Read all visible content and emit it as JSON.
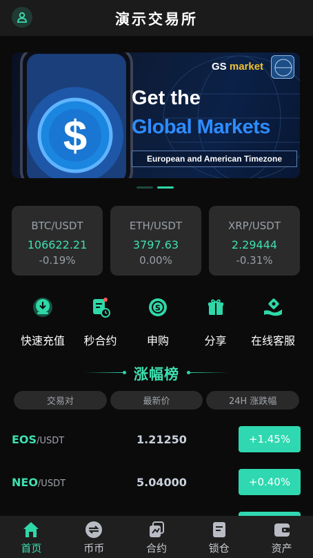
{
  "header": {
    "title": "演示交易所",
    "avatar_icon": "user-icon"
  },
  "banner": {
    "brand_gs": "GS",
    "brand_market": "market",
    "seal_text": "Goldman Sachs",
    "line1": "Get the",
    "line2": "Global Markets",
    "subtitle": "European and American Timezone",
    "active_slide": 1,
    "slide_count": 2
  },
  "tickers": [
    {
      "pair": "BTC/USDT",
      "price": "106622.21",
      "change": "-0.19%"
    },
    {
      "pair": "ETH/USDT",
      "price": "3797.63",
      "change": "0.00%"
    },
    {
      "pair": "XRP/USDT",
      "price": "2.29444",
      "change": "-0.31%"
    }
  ],
  "actions": [
    {
      "label": "快速充值",
      "icon": "deposit-icon"
    },
    {
      "label": "秒合约",
      "icon": "contract-icon"
    },
    {
      "label": "申购",
      "icon": "subscribe-icon"
    },
    {
      "label": "分享",
      "icon": "gift-icon"
    },
    {
      "label": "在线客服",
      "icon": "support-icon"
    }
  ],
  "ranking": {
    "title": "涨幅榜",
    "columns": [
      "交易对",
      "最新价",
      "24H 涨跌幅"
    ],
    "rows": [
      {
        "base": "EOS",
        "quote": "/USDT",
        "price": "1.21250",
        "change": "+1.45%"
      },
      {
        "base": "NEO",
        "quote": "/USDT",
        "price": "5.04000",
        "change": "+0.40%"
      }
    ]
  },
  "tabbar": [
    {
      "label": "首页",
      "icon": "home-icon",
      "active": true
    },
    {
      "label": "币币",
      "icon": "exchange-icon",
      "active": false
    },
    {
      "label": "合约",
      "icon": "contract-tab-icon",
      "active": false
    },
    {
      "label": "锁仓",
      "icon": "lock-icon",
      "active": false
    },
    {
      "label": "资产",
      "icon": "wallet-icon",
      "active": false
    }
  ],
  "colors": {
    "accent": "#2fd8a8",
    "background": "#0b0b0b",
    "card": "#2b2b2b"
  }
}
